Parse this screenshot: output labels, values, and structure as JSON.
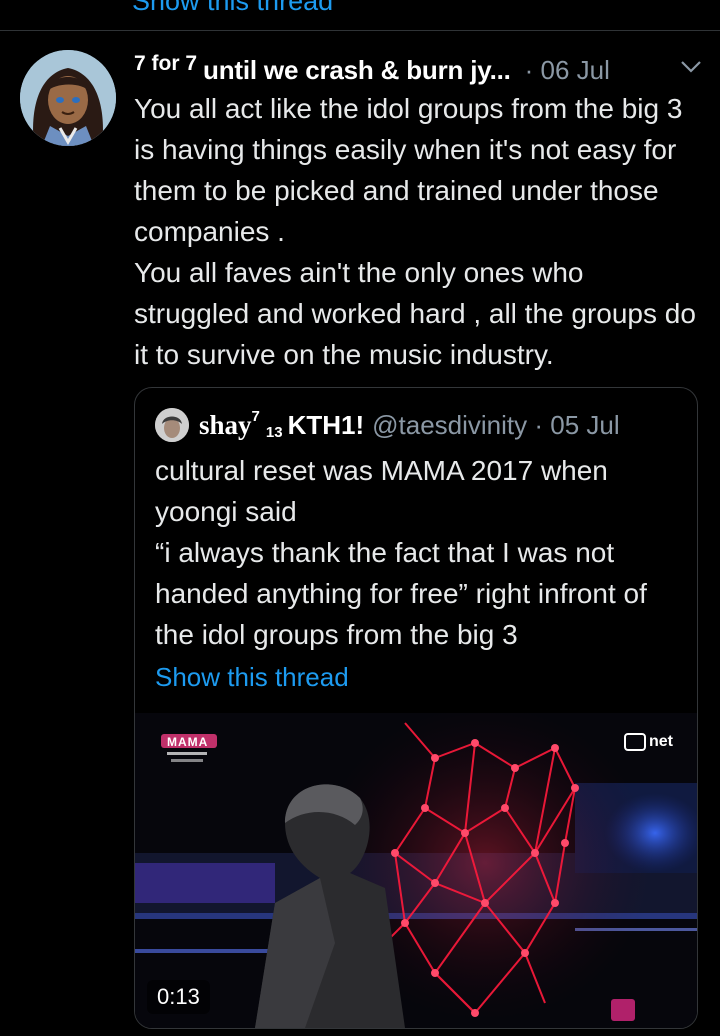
{
  "top": {
    "show_thread_label": "Show this thread"
  },
  "tweet": {
    "sup_left": "7 for 7",
    "author_name": "until we crash & burn jy...",
    "date": "· 06 Jul",
    "body": [
      "You all act like the idol groups from the big 3 is having things easily when it's not easy for them to be picked and trained under those companies .",
      "You all faves ain't the only ones who struggled and worked hard , all the groups do it to survive on the music industry."
    ]
  },
  "quoted": {
    "name": "shay",
    "sup": "7",
    "sub": "13",
    "name2": "KTH1!",
    "handle": "@taesdivinity · 05 Jul",
    "body": [
      "cultural reset was MAMA 2017 when yoongi said",
      " “i always thank the fact that I was not handed anything for free” right infront of the idol groups from the big 3"
    ],
    "show_thread_label": "Show this thread",
    "video": {
      "duration": "0:13",
      "logo_left": "MAMA",
      "logo_right": "net"
    }
  },
  "colors": {
    "accent": "#1d9bf0",
    "muted": "#8b98a5",
    "background": "#000000",
    "laser": "#ff1a3c"
  }
}
